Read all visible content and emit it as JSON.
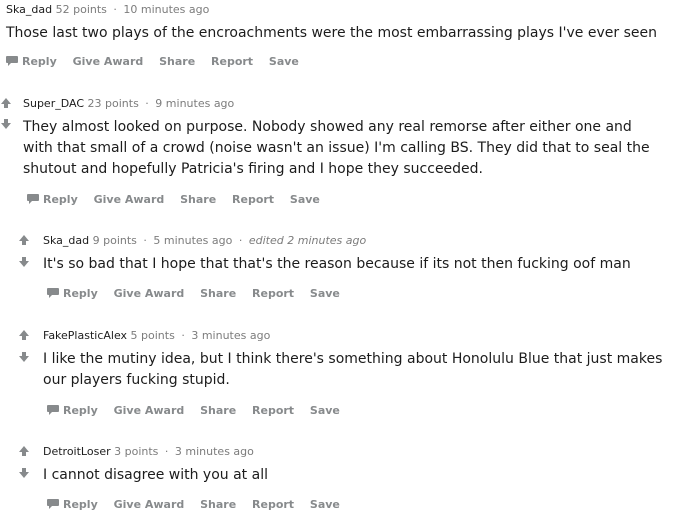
{
  "comments": [
    {
      "author": "Ska_dad",
      "points": "52 points",
      "time": "10 minutes ago",
      "edited": "",
      "text": "Those last two plays of the encroachments were the most embarrassing plays I've ever seen"
    },
    {
      "author": "Super_DAC",
      "points": "23 points",
      "time": "9 minutes ago",
      "edited": "",
      "text": "They almost looked on purpose. Nobody showed any real remorse after either one and with that small of a crowd (noise wasn't an issue) I'm calling BS. They did that to seal the shutout and hopefully Patricia's firing and I hope they succeeded."
    },
    {
      "author": "Ska_dad",
      "points": "9 points",
      "time": "5 minutes ago",
      "edited": "edited 2 minutes ago",
      "text": "It's so bad that I hope that that's the reason because if its not then fucking oof man"
    },
    {
      "author": "FakePlasticAlex",
      "points": "5 points",
      "time": "3 minutes ago",
      "edited": "",
      "text": "I like the mutiny idea, but I think there's something about Honolulu Blue that just makes our players fucking stupid."
    },
    {
      "author": "DetroitLoser",
      "points": "3 points",
      "time": "3 minutes ago",
      "edited": "",
      "text": "I cannot disagree with you at all"
    }
  ],
  "actions": {
    "reply": "Reply",
    "give_award": "Give Award",
    "share": "Share",
    "report": "Report",
    "save": "Save"
  },
  "meta_separator": "·",
  "colors": {
    "text": "#1c1c1c",
    "meta": "#7c7c7c",
    "action": "#878a8c",
    "arrow": "#878a8c"
  }
}
